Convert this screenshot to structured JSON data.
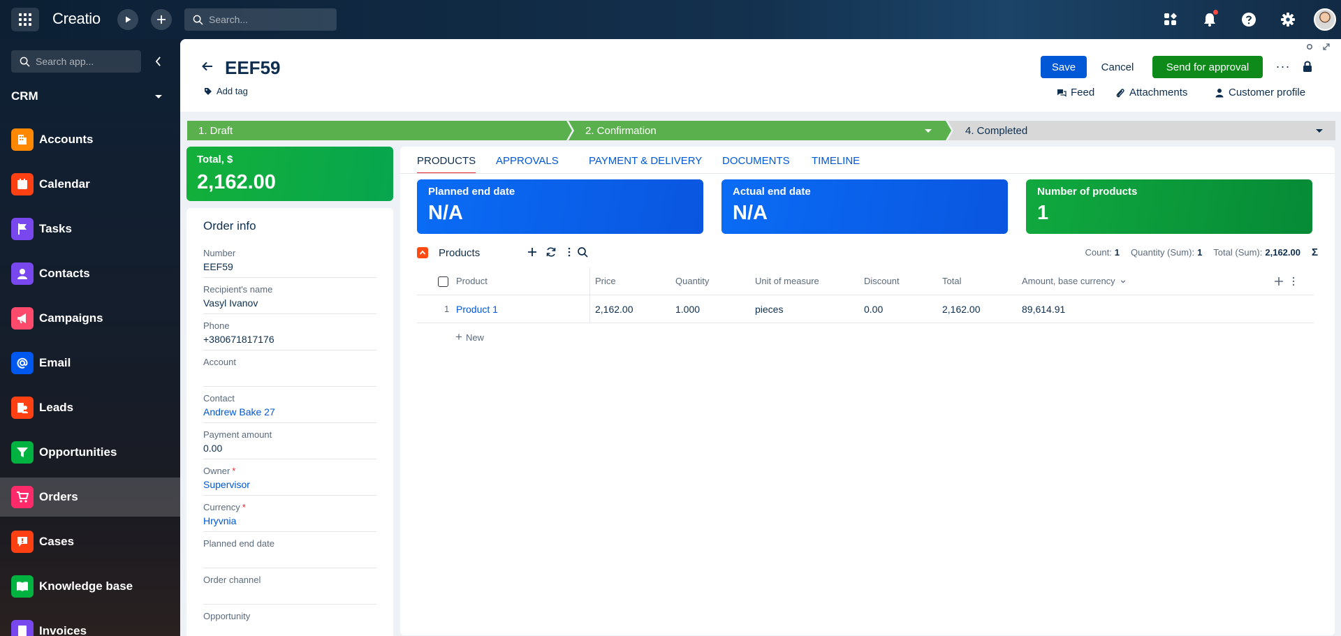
{
  "topbar": {
    "logo": "Creatio",
    "search_placeholder": "Search..."
  },
  "sidebar": {
    "search_placeholder": "Search app...",
    "workspace": "CRM",
    "items": [
      {
        "label": "Accounts",
        "icon": "accounts-icon",
        "color": "#ff8800"
      },
      {
        "label": "Calendar",
        "icon": "calendar-icon",
        "color": "#ff4013"
      },
      {
        "label": "Tasks",
        "icon": "flag-icon",
        "color": "#7848ee"
      },
      {
        "label": "Contacts",
        "icon": "contact-icon",
        "color": "#7848ee"
      },
      {
        "label": "Campaigns",
        "icon": "megaphone-icon",
        "color": "#ff4a6b"
      },
      {
        "label": "Email",
        "icon": "at-icon",
        "color": "#0058ef"
      },
      {
        "label": "Leads",
        "icon": "leads-icon",
        "color": "#ff4013"
      },
      {
        "label": "Opportunities",
        "icon": "funnel-icon",
        "color": "#00b341"
      },
      {
        "label": "Orders",
        "icon": "cart-icon",
        "color": "#ff2a6a"
      },
      {
        "label": "Cases",
        "icon": "case-icon",
        "color": "#ff4013"
      },
      {
        "label": "Knowledge base",
        "icon": "book-icon",
        "color": "#00b341"
      },
      {
        "label": "Invoices",
        "icon": "invoice-icon",
        "color": "#7848ee"
      }
    ],
    "active": "Orders"
  },
  "record": {
    "title": "EEF59",
    "add_tag": "Add tag",
    "buttons": {
      "save": "Save",
      "cancel": "Cancel",
      "send": "Send for approval"
    },
    "links": {
      "feed": "Feed",
      "attachments": "Attachments",
      "customer_profile": "Customer profile"
    }
  },
  "stages": [
    {
      "label": "1. Draft",
      "state": "done"
    },
    {
      "label": "2. Confirmation",
      "state": "current"
    },
    {
      "label": "4. Completed",
      "state": "pending"
    }
  ],
  "total": {
    "label": "Total, $",
    "value": "2,162.00"
  },
  "order_info": {
    "title": "Order info",
    "fields": [
      {
        "label": "Number",
        "value": "EEF59",
        "link": false,
        "required": false
      },
      {
        "label": "Recipient's name",
        "value": "Vasyl Ivanov",
        "link": false,
        "required": false
      },
      {
        "label": "Phone",
        "value": "+380671817176",
        "link": false,
        "required": false
      },
      {
        "label": "Account",
        "value": "",
        "link": false,
        "required": false
      },
      {
        "label": "Contact",
        "value": "Andrew Bake 27",
        "link": true,
        "required": false
      },
      {
        "label": "Payment amount",
        "value": "0.00",
        "link": false,
        "required": false
      },
      {
        "label": "Owner",
        "value": "Supervisor",
        "link": true,
        "required": true
      },
      {
        "label": "Currency",
        "value": "Hryvnia",
        "link": true,
        "required": true
      },
      {
        "label": "Planned end date",
        "value": "",
        "link": false,
        "required": false
      },
      {
        "label": "Order channel",
        "value": "",
        "link": false,
        "required": false
      },
      {
        "label": "Opportunity",
        "value": "",
        "link": false,
        "required": false
      }
    ]
  },
  "tabs": [
    "PRODUCTS",
    "APPROVALS",
    "PAYMENT & DELIVERY",
    "DOCUMENTS",
    "TIMELINE"
  ],
  "metrics": [
    {
      "label": "Planned end date",
      "value": "N/A"
    },
    {
      "label": "Actual end date",
      "value": "N/A"
    },
    {
      "label": "Number of products",
      "value": "1"
    }
  ],
  "products_detail": {
    "title": "Products",
    "summary": {
      "count_label": "Count:",
      "count": "1",
      "qty_label": "Quantity (Sum):",
      "qty": "1",
      "total_label": "Total (Sum):",
      "total": "2,162.00"
    },
    "columns": [
      "Product",
      "Price",
      "Quantity",
      "Unit of measure",
      "Discount",
      "Total",
      "Amount, base currency"
    ],
    "rows": [
      {
        "num": "1",
        "product": "Product 1",
        "price": "2,162.00",
        "quantity": "1.000",
        "unit": "pieces",
        "discount": "0.00",
        "total": "2,162.00",
        "amount_base": "89,614.91"
      }
    ],
    "new_label": "New"
  }
}
